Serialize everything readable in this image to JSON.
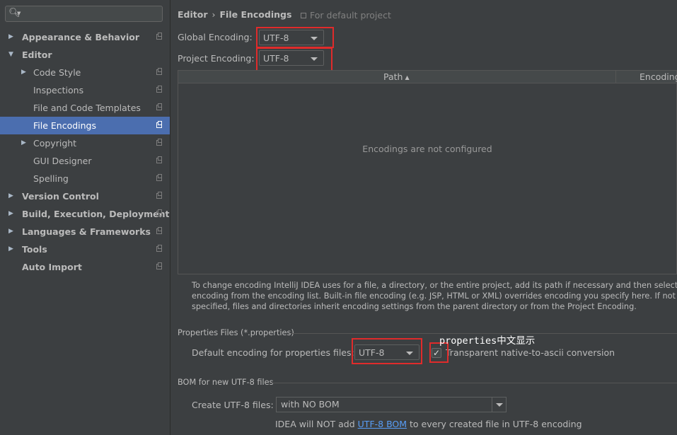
{
  "sidebar": {
    "items": [
      {
        "label": "Appearance & Behavior",
        "bold": true,
        "arrow": "right"
      },
      {
        "label": "Editor",
        "bold": true,
        "arrow": "down"
      },
      {
        "label": "Code Style",
        "bold": false,
        "arrow": "right"
      },
      {
        "label": "Inspections",
        "bold": false,
        "arrow": ""
      },
      {
        "label": "File and Code Templates",
        "bold": false,
        "arrow": ""
      },
      {
        "label": "File Encodings",
        "bold": false,
        "arrow": "",
        "selected": true
      },
      {
        "label": "Copyright",
        "bold": false,
        "arrow": "right"
      },
      {
        "label": "GUI Designer",
        "bold": false,
        "arrow": ""
      },
      {
        "label": "Spelling",
        "bold": false,
        "arrow": ""
      },
      {
        "label": "Version Control",
        "bold": true,
        "arrow": "right"
      },
      {
        "label": "Build, Execution, Deployment",
        "bold": true,
        "arrow": "right"
      },
      {
        "label": "Languages & Frameworks",
        "bold": true,
        "arrow": "right"
      },
      {
        "label": "Tools",
        "bold": true,
        "arrow": "right"
      },
      {
        "label": "Auto Import",
        "bold": true,
        "arrow": ""
      }
    ]
  },
  "breadcrumb": {
    "parent": "Editor",
    "current": "File Encodings",
    "scope": "For default project"
  },
  "global_encoding": {
    "label": "Global Encoding:",
    "value": "UTF-8"
  },
  "project_encoding": {
    "label": "Project Encoding:",
    "value": "UTF-8"
  },
  "table": {
    "col_path": "Path",
    "col_encoding": "Encoding",
    "empty": "Encodings are not configured"
  },
  "description": "To change encoding IntelliJ IDEA uses for a file, a directory, or the entire project, add its path if necessary and then select encoding from the encoding list. Built-in file encoding (e.g. JSP, HTML or XML) overrides encoding you specify here. If not specified, files and directories inherit encoding settings from the parent directory or from the Project Encoding.",
  "properties": {
    "section": "Properties Files (*.properties)",
    "label": "Default encoding for properties files:",
    "value": "UTF-8",
    "checkbox_label": "Transparent native-to-ascii conversion",
    "checked": true
  },
  "annotation": "properties中文显示",
  "bom": {
    "section": "BOM for new UTF-8 files",
    "label": "Create UTF-8 files:",
    "value": "with NO BOM",
    "note_prefix": "IDEA will NOT add ",
    "note_link": "UTF-8 BOM",
    "note_suffix": " to every created file in UTF-8 encoding"
  },
  "colors": {
    "accent": "#4b6eaf",
    "highlight": "#e02b2b",
    "link": "#589df6"
  }
}
